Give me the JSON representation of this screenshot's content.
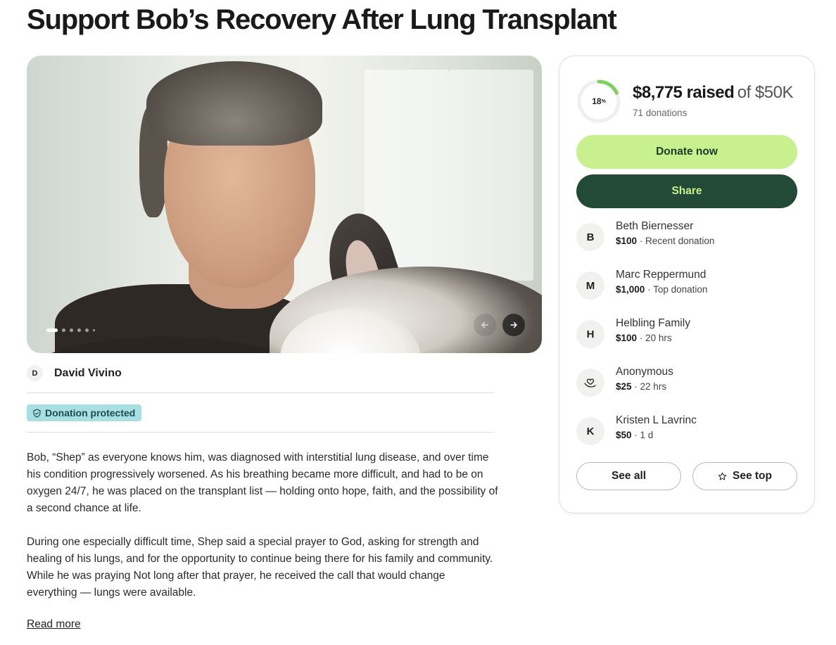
{
  "page": {
    "title": "Support Bob’s Recovery After Lung Transplant"
  },
  "gallery": {
    "slide_count": 6,
    "current_slide": 1
  },
  "organizer": {
    "initial": "D",
    "name": "David Vivino"
  },
  "badge": {
    "label": "Donation protected"
  },
  "story": {
    "paragraphs": [
      "Bob, “Shep” as everyone knows him, was diagnosed with interstitial lung disease, and over time his condition progressively worsened. As his breathing became more difficult, and had to be on oxygen 24/7, he was placed on the transplant list — holding onto hope, faith, and the possibility of a second chance at life.",
      "During one especially difficult time, Shep said a special prayer to God, asking for strength and healing of his lungs, and for the opportunity to continue being there for his family and community. While he was praying Not long after that prayer, he received the call that would change everything — lungs were available."
    ],
    "read_more": "Read more"
  },
  "fundraiser": {
    "progress_percent": 18,
    "progress_label": "18",
    "progress_unit": "%",
    "raised": "$8,775 raised",
    "goal": "of $50K",
    "donations": "71 donations",
    "donate_label": "Donate now",
    "share_label": "Share",
    "see_all_label": "See all",
    "see_top_label": "See top"
  },
  "donors": [
    {
      "initial": "B",
      "name": "Beth Biernesser",
      "amount": "$100",
      "note": "· Recent donation"
    },
    {
      "initial": "M",
      "name": "Marc Reppermund",
      "amount": "$1,000",
      "note": "· Top donation"
    },
    {
      "initial": "H",
      "name": "Helbling Family",
      "amount": "$100",
      "note": "· 20 hrs"
    },
    {
      "initial": "",
      "icon": "heart-hand-icon",
      "name": "Anonymous",
      "amount": "$25",
      "note": "· 22 hrs"
    },
    {
      "initial": "K",
      "name": "Kristen L Lavrinc",
      "amount": "$50",
      "note": "· 1 d"
    }
  ],
  "colors": {
    "donate_bg": "#c8f08f",
    "share_bg": "#234a36",
    "progress": "#7dd35a",
    "badge_bg": "#a8dfe3"
  }
}
